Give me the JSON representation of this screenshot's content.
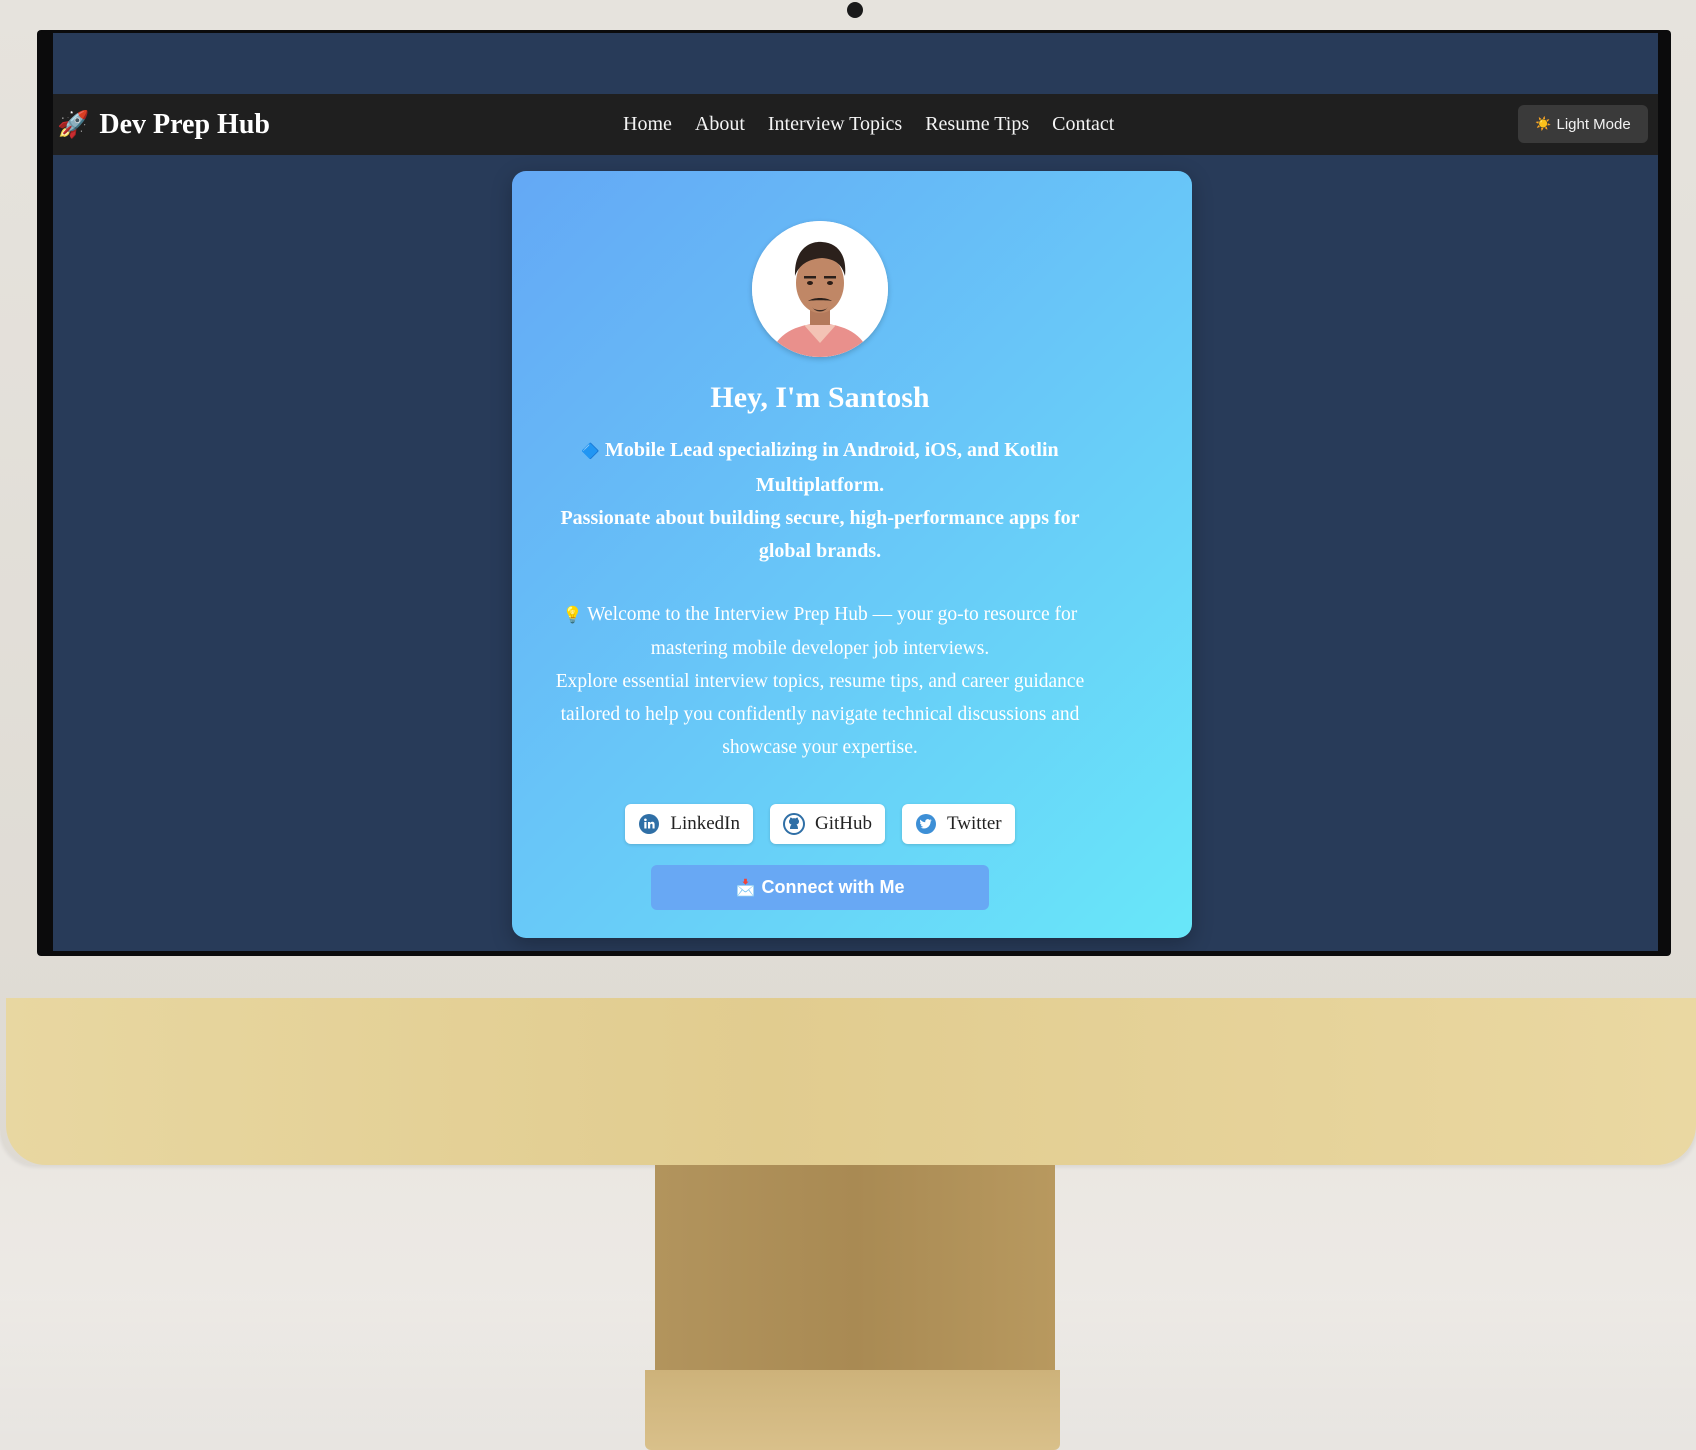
{
  "brand": {
    "icon": "rocket-icon",
    "icon_glyph": "🚀",
    "title": "Dev Prep Hub"
  },
  "nav": {
    "items": [
      "Home",
      "About",
      "Interview Topics",
      "Resume Tips",
      "Contact"
    ]
  },
  "theme_toggle": {
    "icon": "sun-icon",
    "icon_glyph": "☀️",
    "label": "Light Mode"
  },
  "profile": {
    "avatar": "profile-photo",
    "greeting": "Hey, I'm Santosh",
    "tagline_icon": "🔷",
    "tagline_line1": "Mobile Lead specializing in Android, iOS, and Kotlin Multiplatform.",
    "tagline_line2": "Passionate about building secure, high-performance apps for global brands.",
    "welcome_icon": "💡",
    "welcome_line1": "Welcome to the Interview Prep Hub — your go-to resource for mastering mobile developer job interviews.",
    "welcome_line2": "Explore essential interview topics, resume tips, and career guidance tailored to help you confidently navigate technical discussions and showcase your expertise."
  },
  "socials": [
    {
      "label": "LinkedIn",
      "icon": "linkedin-icon"
    },
    {
      "label": "GitHub",
      "icon": "github-icon"
    },
    {
      "label": "Twitter",
      "icon": "twitter-icon"
    }
  ],
  "connect": {
    "icon_glyph": "📩",
    "label": "Connect with Me"
  },
  "colors": {
    "page_bg": "#283b59",
    "navbar_bg": "#1f1f1f",
    "card_gradient_start": "#64a8f5",
    "card_gradient_end": "#68e7f9",
    "connect_button": "#68a8f4"
  }
}
